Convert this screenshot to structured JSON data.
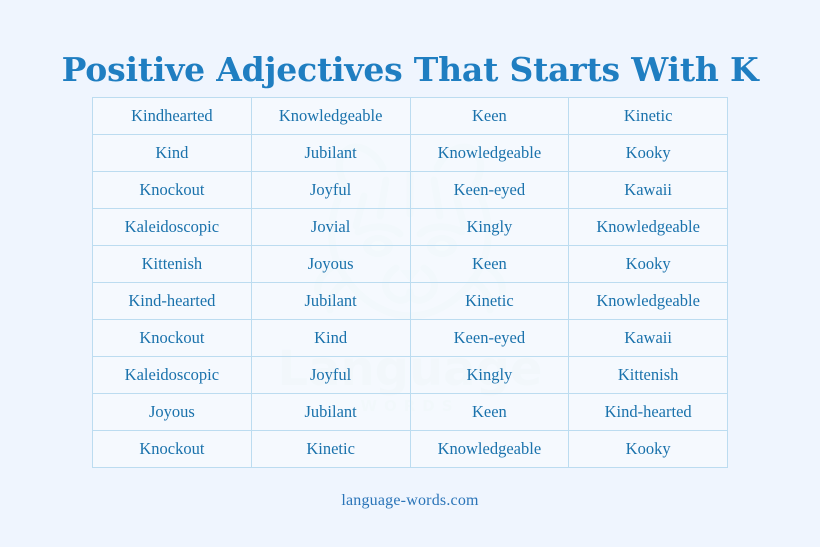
{
  "page": {
    "background_color": "#eff5fe",
    "title": "Positive Adjectives That Starts With K",
    "title_color": "#1f7ec1",
    "footer": "language-words.com",
    "footer_color": "#2a74b8"
  },
  "watermark": {
    "logo_name": "tiger-face-logo",
    "brand_text": "Language",
    "brand_subtext": "WORDS",
    "color": "#e4eef4"
  },
  "table": {
    "border_color": "#bcdcf0",
    "cell_background": "#f6fbfe",
    "text_color": "#1a72ac",
    "columns": 4,
    "rows": [
      [
        "Kindhearted",
        "Knowledgeable",
        "Keen",
        "Kinetic"
      ],
      [
        "Kind",
        "Jubilant",
        "Knowledgeable",
        "Kooky"
      ],
      [
        "Knockout",
        "Joyful",
        "Keen-eyed",
        "Kawaii"
      ],
      [
        "Kaleidoscopic",
        "Jovial",
        "Kingly",
        "Knowledgeable"
      ],
      [
        "Kittenish",
        "Joyous",
        "Keen",
        "Kooky"
      ],
      [
        "Kind-hearted",
        "Jubilant",
        "Kinetic",
        "Knowledgeable"
      ],
      [
        "Knockout",
        "Kind",
        "Keen-eyed",
        "Kawaii"
      ],
      [
        "Kaleidoscopic",
        "Joyful",
        "Kingly",
        "Kittenish"
      ],
      [
        "Joyous",
        "Jubilant",
        "Keen",
        "Kind-hearted"
      ],
      [
        "Knockout",
        "Kinetic",
        "Knowledgeable",
        "Kooky"
      ]
    ]
  }
}
